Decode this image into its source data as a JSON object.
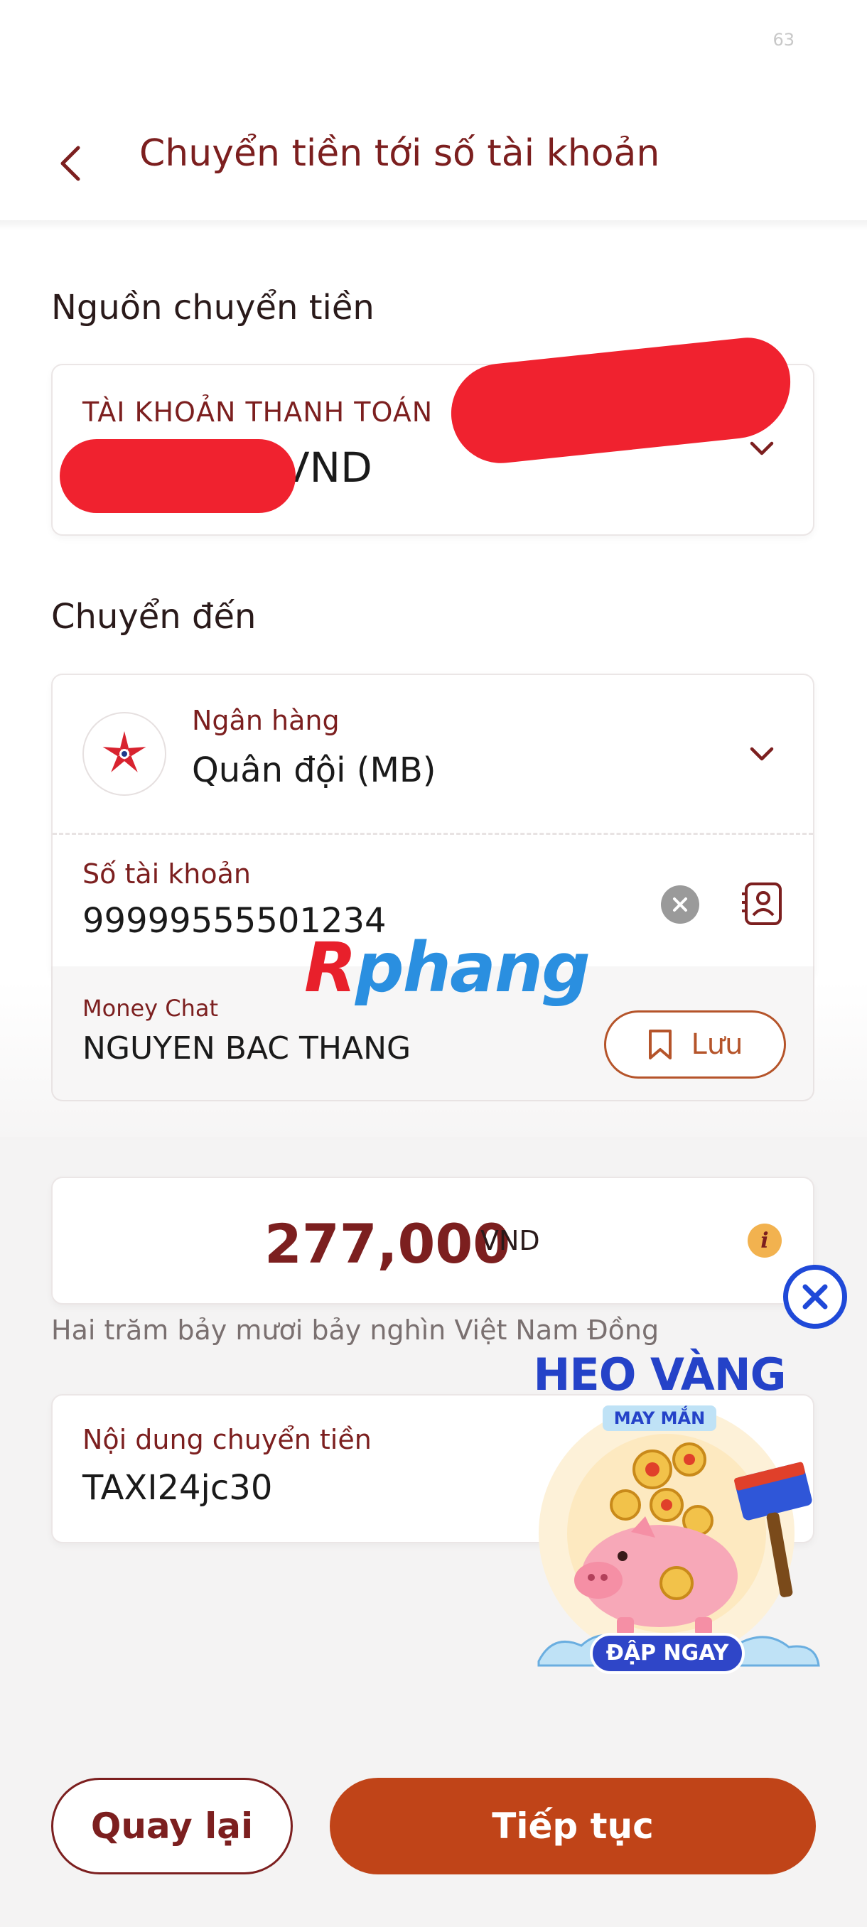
{
  "status": {
    "number": "63"
  },
  "header": {
    "title": "Chuyển tiền tới số tài khoản"
  },
  "source": {
    "section_title": "Nguồn chuyển tiền",
    "account_label": "TÀI KHOẢN THANH TOÁN",
    "currency": "VND"
  },
  "destination": {
    "section_title": "Chuyển đến",
    "bank_label": "Ngân hàng",
    "bank_name": "Quân đội (MB)",
    "account_label": "Số tài khoản",
    "account_number": "99999555501234",
    "beneficiary_label": "Money Chat",
    "beneficiary_name": "NGUYEN BAC THANG",
    "save_label": "Lưu"
  },
  "watermark": "Rphang",
  "amount": {
    "value": "277,000",
    "currency": "VND",
    "words": "Hai trăm bảy mươi bảy nghìn Việt Nam Đồng"
  },
  "content": {
    "label": "Nội dung chuyển tiền",
    "value": "TAXI24jc30"
  },
  "promo": {
    "title": "HEO VÀNG",
    "subtitle": "MAY MẮN",
    "cta": "ĐẬP NGAY"
  },
  "buttons": {
    "back": "Quay lại",
    "next": "Tiếp tục"
  },
  "colors": {
    "brand": "#7c1f1f",
    "accent": "#c04418",
    "promo_blue": "#1f49d8"
  }
}
